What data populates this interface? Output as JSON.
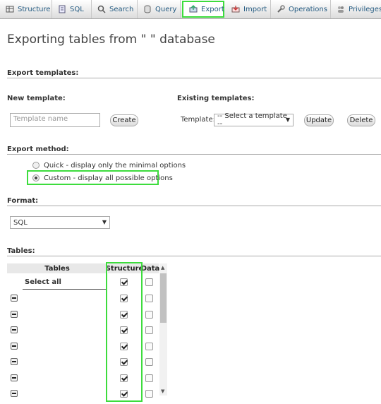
{
  "tabs": [
    {
      "label": "Structure",
      "icon": "structure-icon"
    },
    {
      "label": "SQL",
      "icon": "sql-icon"
    },
    {
      "label": "Search",
      "icon": "search-icon"
    },
    {
      "label": "Query",
      "icon": "query-icon"
    },
    {
      "label": "Export",
      "icon": "export-icon",
      "active": true
    },
    {
      "label": "Import",
      "icon": "import-icon"
    },
    {
      "label": "Operations",
      "icon": "wrench-icon"
    },
    {
      "label": "Privileges",
      "icon": "privileges-icon"
    }
  ],
  "page_title": "Exporting tables from \"                \" database",
  "export_templates": {
    "heading": "Export templates:",
    "new_template_label": "New template:",
    "template_name_placeholder": "Template name",
    "create_label": "Create",
    "existing_templates_label": "Existing templates:",
    "template_label": "Template:",
    "template_select_value": "-- Select a template --",
    "update_label": "Update",
    "delete_label": "Delete"
  },
  "export_method": {
    "heading": "Export method:",
    "quick_label": "Quick - display only the minimal options",
    "custom_label": "Custom - display all possible options",
    "selected": "custom"
  },
  "format": {
    "heading": "Format:",
    "value": "SQL"
  },
  "tables": {
    "heading": "Tables:",
    "col_tables": "Tables",
    "col_structure": "Structure",
    "col_data": "Data",
    "select_all_label": "Select all",
    "select_all_structure": true,
    "select_all_data": false,
    "rows": [
      {
        "name": "",
        "structure": true,
        "data": false
      },
      {
        "name": "",
        "structure": true,
        "data": false
      },
      {
        "name": "",
        "structure": true,
        "data": false
      },
      {
        "name": "",
        "structure": true,
        "data": false
      },
      {
        "name": "",
        "structure": true,
        "data": false
      },
      {
        "name": "",
        "structure": true,
        "data": false
      },
      {
        "name": "",
        "structure": true,
        "data": false
      }
    ]
  },
  "colors": {
    "highlight": "#3ddc3d",
    "tab_text": "#235a81"
  }
}
